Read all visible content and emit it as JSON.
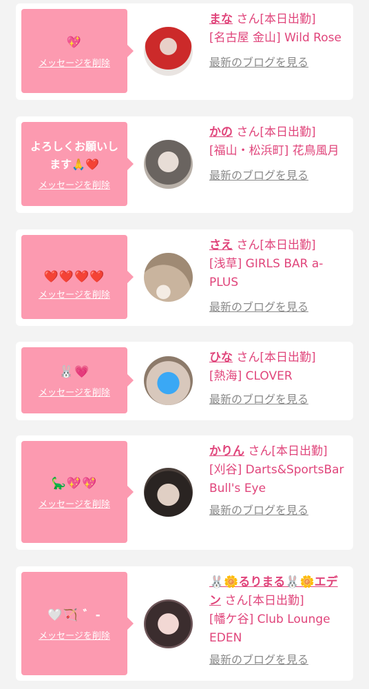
{
  "delete_label": "メッセージを削除",
  "blog_label": "最新のブログを見る",
  "san_label": "さん[本日出勤]",
  "cards": [
    {
      "message": "💖",
      "name": "まな",
      "shop": "[名古屋 金山] Wild Rose"
    },
    {
      "message": "よろしくお願いします🙏❤️",
      "name": "かの",
      "shop": "[福山・松浜町] 花鳥風月"
    },
    {
      "message": "❤️❤️❤️❤️",
      "name": "さえ",
      "shop": "[浅草] GIRLS BAR a-PLUS"
    },
    {
      "message": "🐰💗",
      "name": "ひな",
      "shop": "[熱海] CLOVER"
    },
    {
      "message": "🦕💖💖",
      "name": "かりん",
      "shop": "[刈谷] Darts&SportsBar Bull's Eye"
    },
    {
      "message": "🤍🏹 ゛-",
      "name": "🐰🌼るりまる🐰🌼エデン",
      "shop": "[幡ケ谷] Club Lounge EDEN"
    }
  ],
  "colors": {
    "bubble": "#fc9ab0",
    "accent": "#e0457b",
    "link_gray": "#8a8a8a"
  }
}
